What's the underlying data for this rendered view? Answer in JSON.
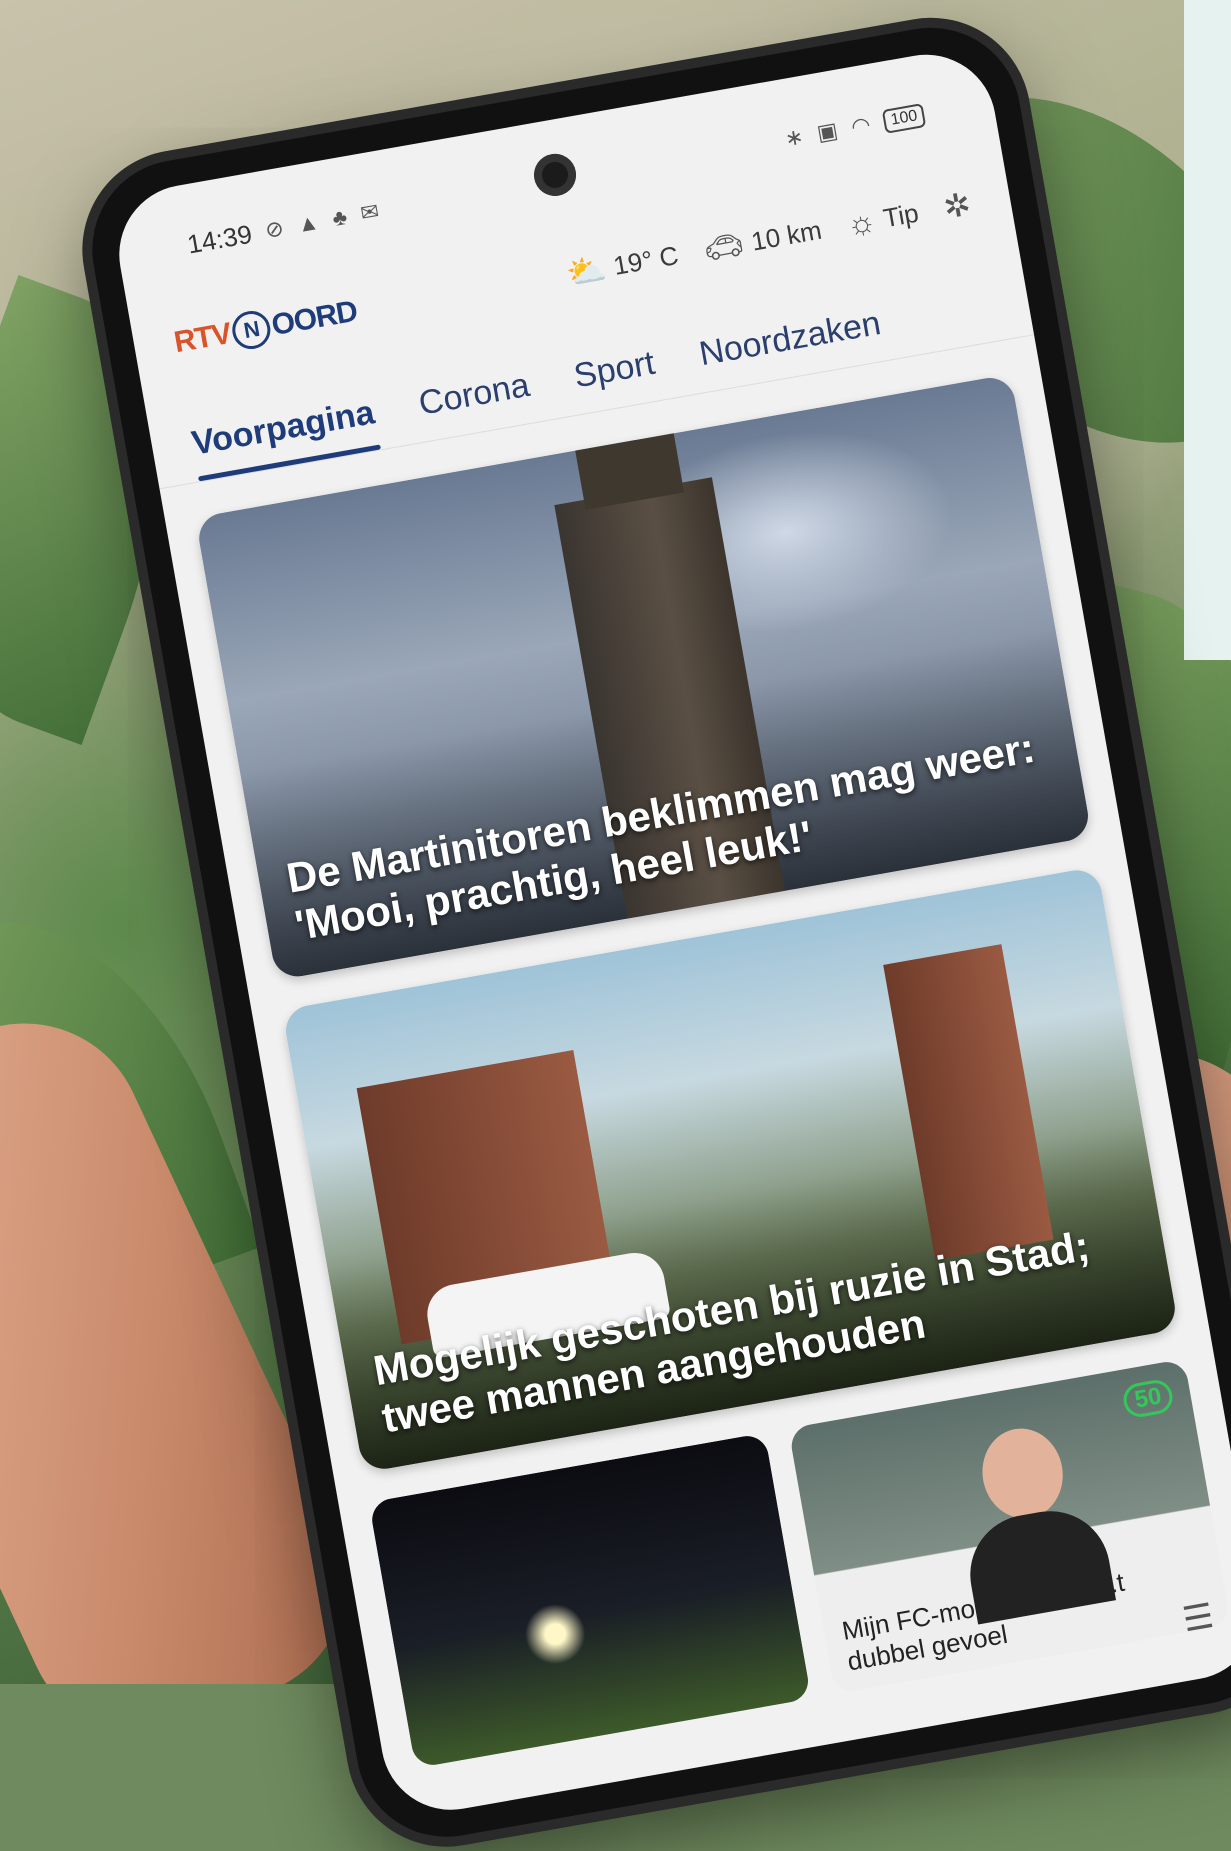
{
  "status_bar": {
    "time": "14:39",
    "left_icons": [
      "no-alarm-icon",
      "navigation-icon",
      "app-icon",
      "mail-icon"
    ],
    "right_icons": [
      "bluetooth-icon",
      "nfc-icon",
      "wifi-icon"
    ],
    "battery": "100"
  },
  "app_bar": {
    "logo_rtv": "RTV",
    "logo_noord": "OORD",
    "weather": "19° C",
    "traffic": "10 km",
    "tip": "Tip",
    "icons": [
      "weather-sun-cloud-icon",
      "car-icon",
      "lightbulb-icon",
      "bug-icon"
    ]
  },
  "tabs": [
    {
      "label": "Voorpagina",
      "active": true
    },
    {
      "label": "Corona",
      "active": false
    },
    {
      "label": "Sport",
      "active": false
    },
    {
      "label": "Noordzaken",
      "active": false
    }
  ],
  "articles": [
    {
      "headline": "De Martinitoren beklimmen mag weer: 'Mooi, prachtig, heel leuk!'"
    },
    {
      "headline": "Mogelijk geschoten bij ruzie in Stad; twee mannen aangehouden"
    },
    {
      "headline": ""
    },
    {
      "headline": "Mijn FC-moment: een ...t dubbel gevoel",
      "badge": "50"
    }
  ]
}
